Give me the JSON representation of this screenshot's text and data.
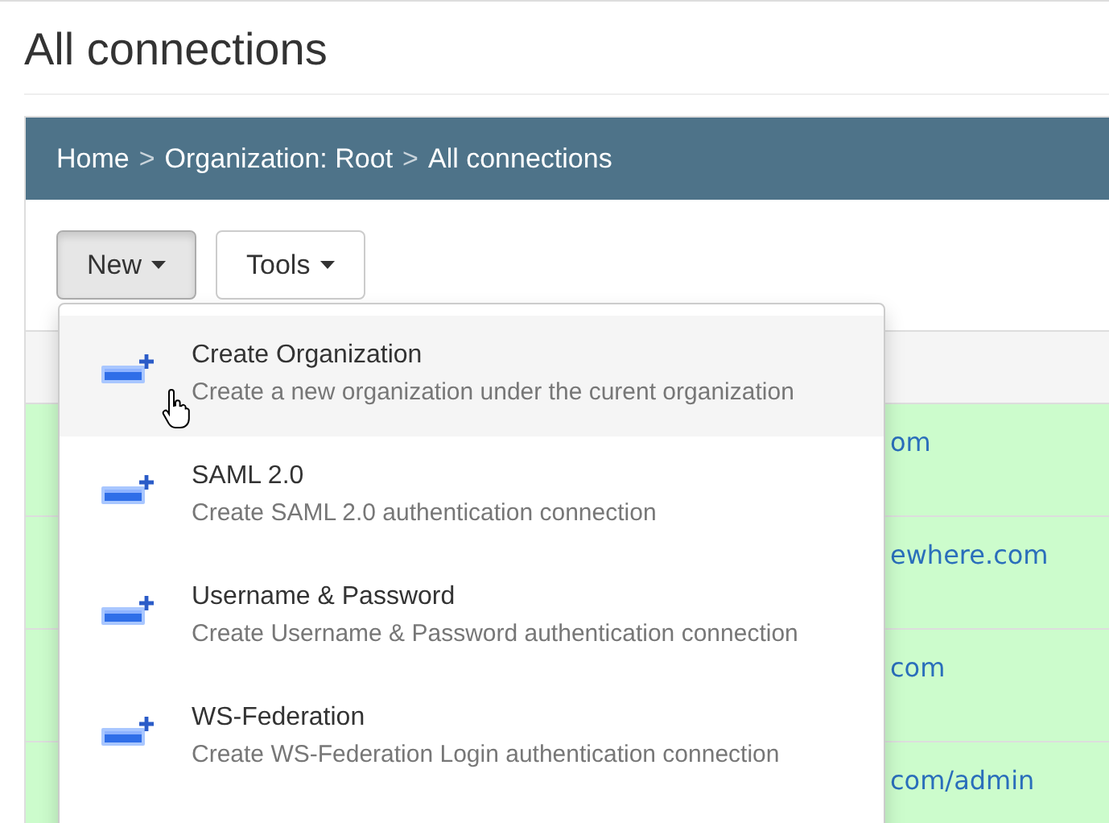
{
  "page_title": "All connections",
  "breadcrumb": [
    {
      "label": "Home"
    },
    {
      "label": "Organization: Root"
    },
    {
      "label": "All connections"
    }
  ],
  "breadcrumb_separator": ">",
  "toolbar": [
    {
      "label": "New",
      "selected": true
    },
    {
      "label": "Tools",
      "selected": false
    }
  ],
  "menu": [
    {
      "title": "Create Organization",
      "description": "Create a new organization under the curent organization",
      "selected": true
    },
    {
      "title": "SAML 2.0",
      "description": "Create SAML 2.0 authentication connection",
      "selected": false
    },
    {
      "title": "Username & Password",
      "description": "Create Username & Password authentication connection",
      "selected": false
    },
    {
      "title": "WS-Federation",
      "description": "Create WS-Federation Login authentication connection",
      "selected": false
    }
  ],
  "table": {
    "rows": [
      {
        "cell": "om"
      },
      {
        "cell": "ewhere.com"
      },
      {
        "cell": "com"
      },
      {
        "cell": "com/admin"
      }
    ]
  }
}
